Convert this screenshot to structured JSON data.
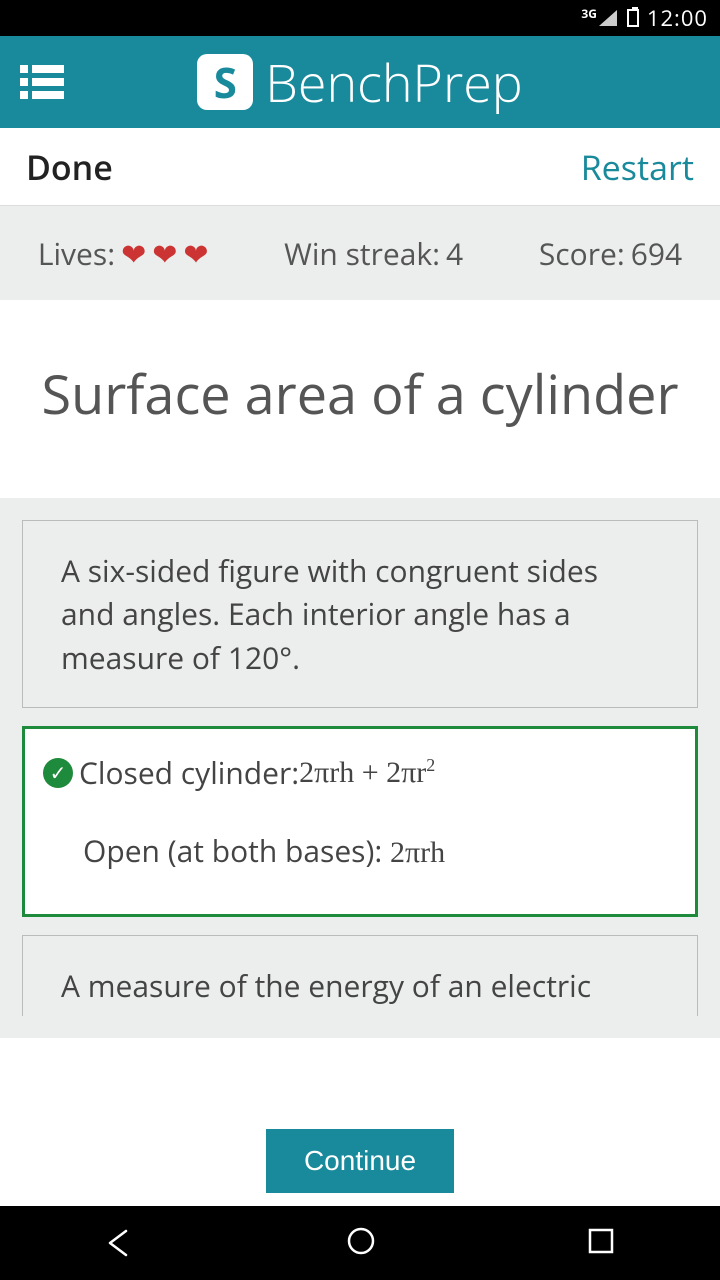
{
  "statusbar": {
    "network": "3G",
    "time": "12:00"
  },
  "appheader": {
    "brand": "BenchPrep"
  },
  "subheader": {
    "done": "Done",
    "restart": "Restart"
  },
  "stats": {
    "lives_label": "Lives:",
    "lives": 3,
    "streak_label": "Win streak:",
    "streak": "4",
    "score_label": "Score:",
    "score": "694"
  },
  "question": {
    "title": "Surface area of a cylinder"
  },
  "options": {
    "a": "A six-sided figure with congruent sides and angles. Each interior angle has a measure of 120°.",
    "b_closed_label": "Closed cylinder: ",
    "b_closed_formula": "2πrh + 2πr",
    "b_closed_exp": "2",
    "b_open_label": "Open (at both bases): ",
    "b_open_formula": "2πrh",
    "c": "A measure of the energy of an electric"
  },
  "footer": {
    "continue": "Continue"
  }
}
